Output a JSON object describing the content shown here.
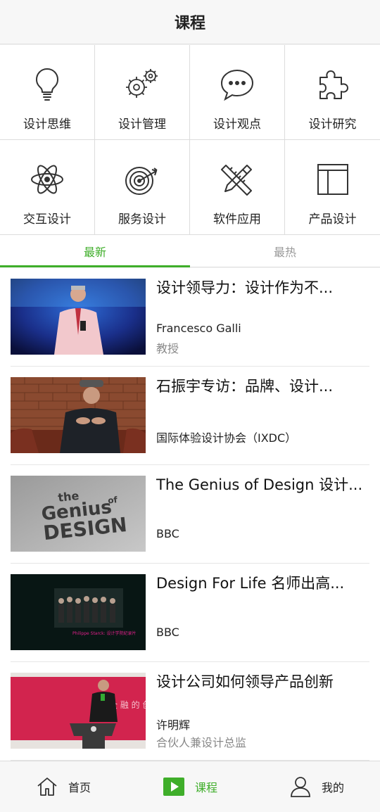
{
  "header": {
    "title": "课程"
  },
  "categories": [
    {
      "label": "设计思维",
      "icon": "lightbulb-icon"
    },
    {
      "label": "设计管理",
      "icon": "gears-icon"
    },
    {
      "label": "设计观点",
      "icon": "speech-bubble-icon"
    },
    {
      "label": "设计研究",
      "icon": "puzzle-icon"
    },
    {
      "label": "交互设计",
      "icon": "atom-icon"
    },
    {
      "label": "服务设计",
      "icon": "target-arrow-icon"
    },
    {
      "label": "软件应用",
      "icon": "pencil-ruler-icon"
    },
    {
      "label": "产品设计",
      "icon": "layout-icon"
    }
  ],
  "tabs": [
    {
      "label": "最新",
      "active": true
    },
    {
      "label": "最热",
      "active": false
    }
  ],
  "courses": [
    {
      "title": "设计领导力：设计作为不...",
      "author": "Francesco Galli",
      "role": "教授",
      "thumb": "speaker-stage-thumbnail"
    },
    {
      "title": "石振宇专访：品牌、设计...",
      "author": "国际体验设计协会（IXDC）",
      "role": "",
      "thumb": "interview-thumbnail"
    },
    {
      "title": "The Genius of Design 设计...",
      "author": "BBC",
      "role": "",
      "thumb": "genius-of-design-thumbnail"
    },
    {
      "title": "Design For Life 名师出高...",
      "author": "BBC",
      "role": "",
      "thumb": "design-for-life-thumbnail"
    },
    {
      "title": "设计公司如何领导产品创新",
      "author": "许明辉",
      "role": "合伙人兼设计总监",
      "thumb": "conference-speaker-thumbnail"
    }
  ],
  "thumb_texts": {
    "genius_the": "the",
    "genius_main": "Genius",
    "genius_of": "of",
    "genius_design": "DESIGN",
    "philippe": "Philippe Starck: 设计学院纪录片",
    "banner": "全 融 的 创"
  },
  "bottom_nav": [
    {
      "label": "首页",
      "icon": "home-icon",
      "active": false
    },
    {
      "label": "课程",
      "icon": "play-icon",
      "active": true
    },
    {
      "label": "我的",
      "icon": "user-icon",
      "active": false
    }
  ],
  "colors": {
    "accent": "#3fae2a",
    "text": "#222222",
    "muted": "#888888"
  }
}
